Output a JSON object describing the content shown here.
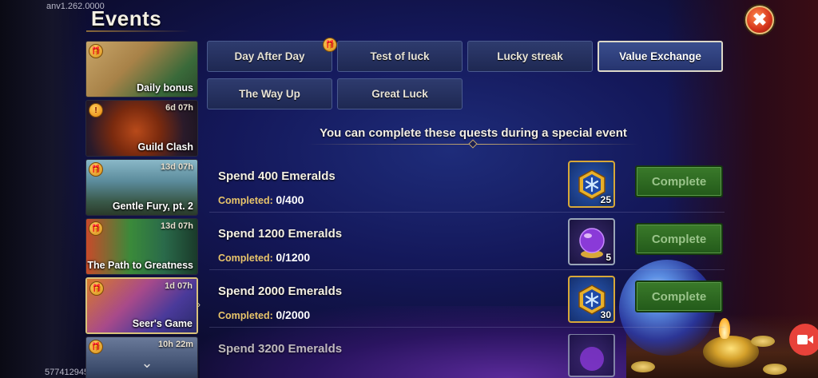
{
  "app": {
    "version": "anv1.262.0000",
    "footer_id": "577412945",
    "title": "Events"
  },
  "colors": {
    "accent_gold": "#d8a838",
    "tab_bg": "#26346e",
    "complete_green": "#2f6a22",
    "close_red": "#d4321a"
  },
  "sidebar": {
    "items": [
      {
        "label": "Daily bonus",
        "time": "",
        "badge": "gift-badge-icon",
        "selected": false
      },
      {
        "label": "Guild Clash",
        "time": "6d 07h",
        "badge": "alert-badge-icon",
        "selected": false
      },
      {
        "label": "Gentle Fury, pt. 2",
        "time": "13d 07h",
        "badge": "gift-badge-icon",
        "selected": false
      },
      {
        "label": "The Path to Greatness",
        "time": "13d 07h",
        "badge": "gift-badge-icon",
        "selected": false
      },
      {
        "label": "Seer's Game",
        "time": "1d 07h",
        "badge": "gift-badge-icon",
        "selected": true
      },
      {
        "label": "",
        "time": "10h 22m",
        "badge": "gift-badge-icon",
        "selected": false
      }
    ]
  },
  "tabs": [
    {
      "label": "Day After Day",
      "active": false,
      "has_badge": true
    },
    {
      "label": "Test of luck",
      "active": false,
      "has_badge": false
    },
    {
      "label": "Lucky streak",
      "active": false,
      "has_badge": false
    },
    {
      "label": "Value Exchange",
      "active": true,
      "has_badge": false
    },
    {
      "label": "The Way Up",
      "active": false,
      "has_badge": false
    },
    {
      "label": "Great Luck",
      "active": false,
      "has_badge": false
    }
  ],
  "subtitle": "You can complete these quests during a special event",
  "quests": [
    {
      "title": "Spend 400 Emeralds",
      "progress_label": "Completed:",
      "progress_value": "0/400",
      "reward_icon": "snowflake-emblem-icon",
      "reward_count": "25",
      "button": "Complete"
    },
    {
      "title": "Spend 1200 Emeralds",
      "progress_label": "Completed:",
      "progress_value": "0/1200",
      "reward_icon": "crystal-ball-icon",
      "reward_count": "5",
      "button": "Complete"
    },
    {
      "title": "Spend 2000 Emeralds",
      "progress_label": "Completed:",
      "progress_value": "0/2000",
      "reward_icon": "snowflake-emblem-icon",
      "reward_count": "30",
      "button": "Complete"
    },
    {
      "title": "Spend 3200 Emeralds",
      "progress_label": "",
      "progress_value": "",
      "reward_icon": "crystal-ball-icon",
      "reward_count": "",
      "button": ""
    }
  ],
  "icons": {
    "close": "close-icon",
    "scroll_down": "chevron-down-icon",
    "record": "screen-record-icon"
  }
}
